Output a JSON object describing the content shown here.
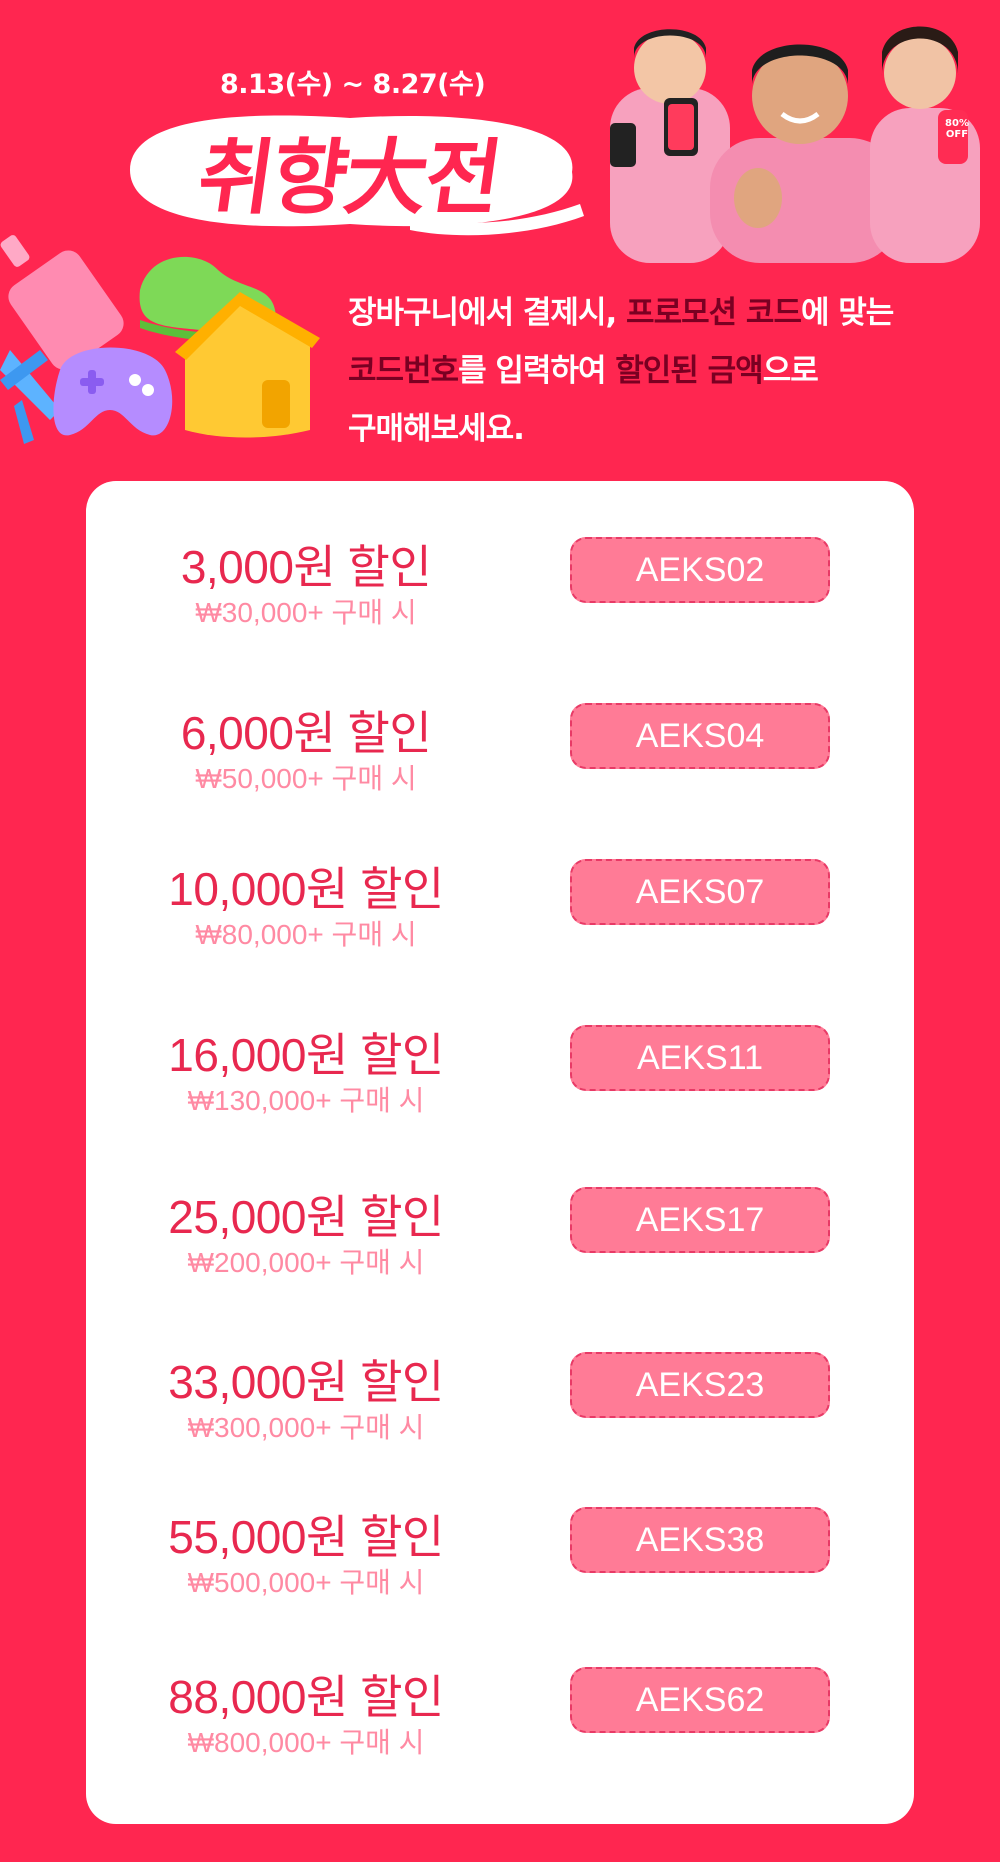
{
  "banner": {
    "date_range": "8.13(수) ~ 8.27(수)",
    "logo_text": "취향大전",
    "phone_badge": "80%\nOFF",
    "instruction": {
      "p1": "장바구니에서 결제시, ",
      "h1": "프로모션 코드",
      "p2": "에 맞는",
      "h2": "코드번호",
      "p3": "를 입력하여 ",
      "h3": "할인된 금액",
      "p4": "으로",
      "p5": "구매해보세요."
    }
  },
  "coupons": [
    {
      "amount": "3,000원 할인",
      "condition": "₩30,000+ 구매 시",
      "code": "AEKS02"
    },
    {
      "amount": "6,000원 할인",
      "condition": "₩50,000+ 구매 시",
      "code": "AEKS04"
    },
    {
      "amount": "10,000원 할인",
      "condition": "₩80,000+ 구매 시",
      "code": "AEKS07"
    },
    {
      "amount": "16,000원 할인",
      "condition": "₩130,000+ 구매 시",
      "code": "AEKS11"
    },
    {
      "amount": "25,000원 할인",
      "condition": "₩200,000+ 구매 시",
      "code": "AEKS17"
    },
    {
      "amount": "33,000원 할인",
      "condition": "₩300,000+ 구매 시",
      "code": "AEKS23"
    },
    {
      "amount": "55,000원 할인",
      "condition": "₩500,000+ 구매 시",
      "code": "AEKS38"
    },
    {
      "amount": "88,000원 할인",
      "condition": "₩800,000+ 구매 시",
      "code": "AEKS62"
    }
  ],
  "colors": {
    "background": "#ff2650",
    "highlight_text": "#7a0022",
    "amount_text": "#e8284f",
    "condition_text": "#ff8aa3",
    "code_fill": "#ff7b96",
    "code_border": "#e83a66"
  }
}
